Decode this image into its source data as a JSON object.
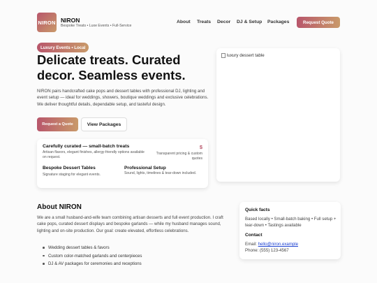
{
  "brand": {
    "logo_text": "NIRON",
    "name": "NIRON",
    "tagline": "Bespoke Treats • Luxe Events • Full-Service"
  },
  "nav": {
    "about": "About",
    "treats": "Treats",
    "decor": "Decor",
    "dj": "DJ & Setup",
    "packages": "Packages",
    "quote_button": "Request Quote"
  },
  "hero": {
    "badge": "Luxury Events • Local",
    "title": "Delicate treats. Curated decor. Seamless events.",
    "description": "NIRON pairs handcrafted cake pops and dessert tables with professional DJ, lighting and event setup — ideal for weddings, showers, boutique weddings and exclusive celebrations. We deliver thoughtful details, dependable setup, and tasteful design.",
    "primary_button": "Request a Quote",
    "secondary_button": "View Packages",
    "image_alt": "luxury dessert table"
  },
  "card": {
    "title": "Carefully curated — small-batch treats",
    "subtitle": "Artisan flavors, elegant finishes, allergy-friendly options available on request.",
    "price": "$",
    "price_note": "Transparent pricing & custom quotes",
    "feature1_title": "Bespoke Dessert Tables",
    "feature1_desc": "Signature staging for elegant events.",
    "feature2_title": "Professional Setup",
    "feature2_desc": "Sound, lights, timelines & tear-down included."
  },
  "about": {
    "title": "About NIRON",
    "text": "We are a small husband-and-wife team combining artisan desserts and full event production. I craft cake pops, curated dessert displays and bespoke garlands — while my husband manages sound, lighting and on-site production. Our goal: create elevated, effortless celebrations.",
    "list": [
      "Wedding dessert tables & favors",
      "Custom color-matched garlands and centerpieces",
      "DJ & AV packages for ceremonies and receptions"
    ]
  },
  "quick_facts": {
    "title": "Quick facts",
    "text": "Based locally • Small-batch baking • Full setup + tear-down • Tastings available",
    "contact_title": "Contact",
    "email_label": "Email:",
    "email": "hello@niron.example",
    "phone": "Phone: (555) 123-4567"
  },
  "colors": {
    "accent_start": "#b8566b",
    "accent_end": "#c99a6a",
    "link": "#1a3fd1"
  }
}
